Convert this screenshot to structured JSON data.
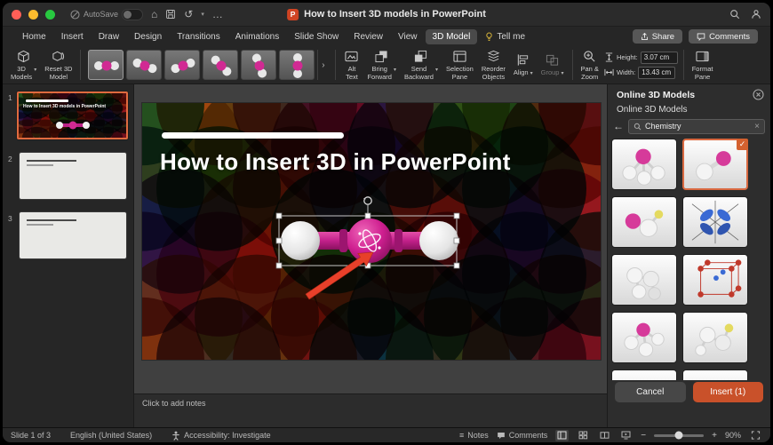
{
  "theme": {
    "accent_orange": "#d4612f",
    "selection_border": "#d96941",
    "insert_button": "#c9512a",
    "brand_red": "#d04423",
    "molecule_magenta": "#c2258a"
  },
  "icons": {
    "home": "⌂",
    "undo": "↺",
    "more": "…",
    "caret": "▾",
    "back": "←",
    "clear": "×",
    "check": "✓",
    "minus": "−",
    "plus": "+",
    "gallery_more": "›",
    "notes": "≡"
  },
  "titlebar": {
    "autosave_label": "AutoSave",
    "app_badge": "P",
    "doc_title": "How to Insert 3D models in PowerPoint"
  },
  "ribbon_tabs": {
    "tabs": [
      {
        "label": "Home"
      },
      {
        "label": "Insert"
      },
      {
        "label": "Draw"
      },
      {
        "label": "Design"
      },
      {
        "label": "Transitions"
      },
      {
        "label": "Animations"
      },
      {
        "label": "Slide Show"
      },
      {
        "label": "Review"
      },
      {
        "label": "View"
      },
      {
        "label": "3D Model"
      },
      {
        "label": "Tell me"
      }
    ],
    "share_label": "Share",
    "comments_label": "Comments"
  },
  "ribbon": {
    "models_3d": "3D\nModels",
    "reset_model": "Reset 3D\nModel",
    "alt_text": "Alt\nText",
    "bring_forward": "Bring\nForward",
    "send_backward": "Send\nBackward",
    "selection_pane": "Selection\nPane",
    "reorder_objects": "Reorder\nObjects",
    "align": "Align",
    "group": "Group",
    "pan_zoom": "Pan &\nZoom",
    "height_label": "Height:",
    "height_value": "3.07 cm",
    "width_label": "Width:",
    "width_value": "13.43 cm",
    "format_pane": "Format\nPane"
  },
  "slides_panel": {
    "slides": [
      {
        "number": "1",
        "title": "How to Insert 3D models in PowerPoint",
        "selected": true
      },
      {
        "number": "2",
        "selected": false
      },
      {
        "number": "3",
        "selected": false
      }
    ]
  },
  "slide": {
    "title": "How to Insert 3D in PowerPoint",
    "pattern_palette": [
      "#1f7d7d",
      "#d96b2f",
      "#7d3f7d",
      "#c22a7f",
      "#cfa52f",
      "#7d8a2f",
      "#8a2438",
      "#2f5d7d",
      "#2f7d4f",
      "#a8442f",
      "#5d3f8a",
      "#d9542f"
    ]
  },
  "notes": {
    "placeholder": "Click to add notes"
  },
  "panel": {
    "title": "Online 3D Models",
    "subtitle": "Online 3D Models",
    "search_value": "Chemistry",
    "cancel_label": "Cancel",
    "insert_label": "Insert (1)"
  },
  "statusbar": {
    "slide_info": "Slide 1 of 3",
    "language": "English (United States)",
    "accessibility": "Accessibility: Investigate",
    "notes_label": "Notes",
    "comments_label": "Comments",
    "zoom_level": "90%"
  }
}
